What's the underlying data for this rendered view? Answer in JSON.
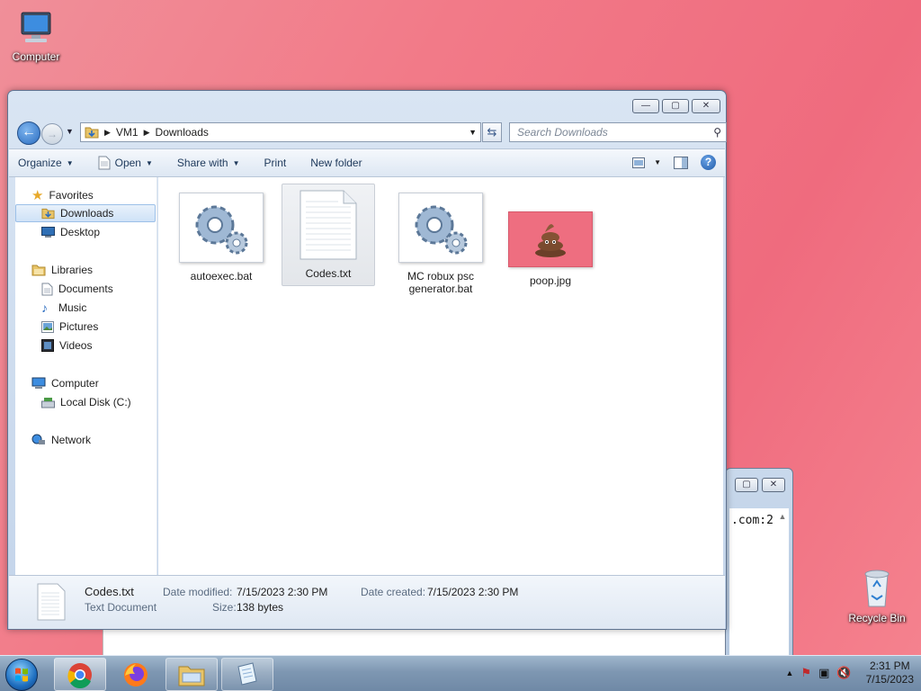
{
  "desktop": {
    "computer_label": "Computer",
    "recycle_label": "Recycle Bin"
  },
  "background_window": {
    "text": ".com:2"
  },
  "explorer": {
    "caption": {
      "minimize": "—",
      "maximize": "▢",
      "close": "✕"
    },
    "address": {
      "crumbs": [
        "VM1",
        "Downloads"
      ]
    },
    "search": {
      "placeholder": "Search Downloads"
    },
    "toolbar": {
      "organize": "Organize",
      "open": "Open",
      "share_with": "Share with",
      "print": "Print",
      "new_folder": "New folder"
    },
    "nav": {
      "favorites": "Favorites",
      "downloads": "Downloads",
      "desktop": "Desktop",
      "libraries": "Libraries",
      "documents": "Documents",
      "music": "Music",
      "pictures": "Pictures",
      "videos": "Videos",
      "computer": "Computer",
      "local_disk": "Local Disk (C:)",
      "network": "Network"
    },
    "files": [
      {
        "name": "autoexec.bat",
        "icon": "gears-icon"
      },
      {
        "name": "Codes.txt",
        "icon": "text-document-icon"
      },
      {
        "name": "MC robux psc generator.bat",
        "icon": "gears-icon"
      },
      {
        "name": "poop.jpg",
        "icon": "image-thumbnail"
      }
    ],
    "details": {
      "name": "Codes.txt",
      "type": "Text Document",
      "modified_label": "Date modified:",
      "modified_value": "7/15/2023 2:30 PM",
      "created_label": "Date created:",
      "created_value": "7/15/2023 2:30 PM",
      "size_label": "Size:",
      "size_value": "138 bytes"
    }
  },
  "taskbar": {
    "time": "2:31 PM",
    "date": "7/15/2023"
  },
  "colors": {
    "desktop_bg": "#f27a88",
    "selection": "#cfe2f7",
    "accent": "#1e395b"
  }
}
